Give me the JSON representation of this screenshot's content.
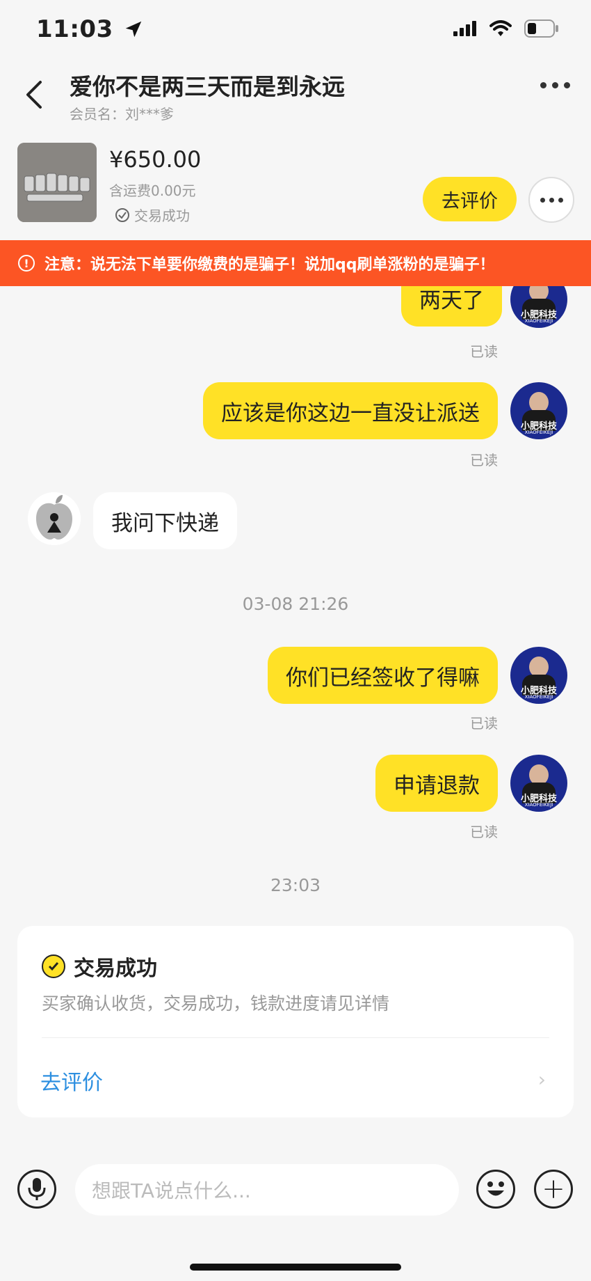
{
  "status_bar": {
    "time": "11:03"
  },
  "header": {
    "title": "爱你不是两三天而是到永远",
    "member_label": "会员名：刘***爹"
  },
  "product": {
    "price": "¥650.00",
    "shipping": "含运费0.00元",
    "status": "交易成功",
    "rate_button": "去评价"
  },
  "warning": {
    "text": "注意：说无法下单要你缴费的是骗子！说加qq刷单涨粉的是骗子！"
  },
  "chat": {
    "avatar_label": "小肥科技",
    "avatar_sub": "XIAOFEIKEJI",
    "messages": [
      {
        "text": "两天了",
        "read": "已读"
      },
      {
        "text": "应该是你这边一直没让派送",
        "read": "已读"
      },
      {
        "text": "我问下快递"
      },
      {
        "text": "你们已经签收了得嘛",
        "read": "已读"
      },
      {
        "text": "申请退款",
        "read": "已读"
      }
    ],
    "timestamps": [
      "03-08 21:26",
      "23:03"
    ]
  },
  "transaction_card": {
    "title": "交易成功",
    "description": "买家确认收货，交易成功，钱款进度请见详情",
    "action": "去评价"
  },
  "input_bar": {
    "placeholder": "想跟TA说点什么..."
  },
  "icons": [
    "location-arrow-icon",
    "signal-icon",
    "wifi-icon",
    "battery-icon",
    "back-icon",
    "more-icon",
    "check-icon",
    "alert-icon",
    "mic-icon",
    "emoji-icon",
    "plus-icon",
    "chevron-right-icon"
  ],
  "colors": {
    "accent": "#ffe126",
    "warning": "#fc5524",
    "link": "#2d8fe0"
  }
}
